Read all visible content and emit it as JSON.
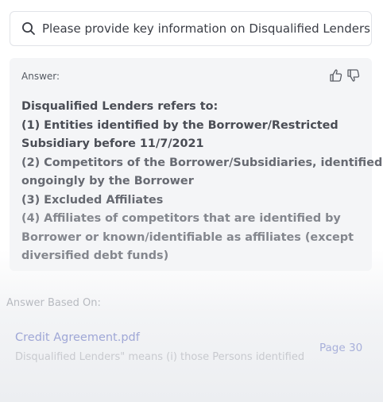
{
  "search": {
    "query": "Please provide key information on Disqualified Lenders",
    "icon": "search-icon"
  },
  "answer": {
    "label": "Answer:",
    "feedback": {
      "up_icon": "thumbs-up-icon",
      "down_icon": "thumbs-down-icon"
    },
    "lines": [
      "Disqualified Lenders refers to:",
      "(1) Entities identified by the Borrower/Restricted",
      "Subsidiary before 11/7/2021",
      "(2) Competitors of the Borrower/Subsidiaries, identified",
      "ongoingly by the Borrower",
      "(3) Excluded Affiliates",
      "(4) Affiliates of competitors that are identified by",
      "Borrower or known/identifiable as affiliates (except",
      "diversified debt funds)"
    ]
  },
  "sources": {
    "heading": "Answer Based On:",
    "items": [
      {
        "title": "Credit Agreement.pdf",
        "snippet": "Disqualified Lenders\" means (i) those Persons identified",
        "page": "Page 30"
      }
    ]
  },
  "colors": {
    "card_bg": "#f4f5f7",
    "source_link": "#9fa7d6"
  }
}
